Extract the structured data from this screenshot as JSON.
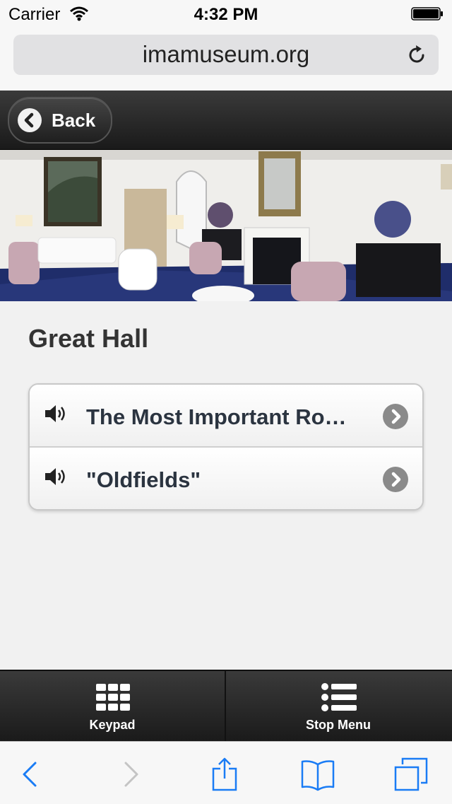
{
  "status_bar": {
    "carrier": "Carrier",
    "time": "4:32 PM",
    "wifi_icon": "wifi-icon",
    "battery_icon": "battery-icon"
  },
  "browser": {
    "url": "imamuseum.org",
    "reload_icon": "reload-icon"
  },
  "header": {
    "back_label": "Back",
    "back_icon": "chevron-left-icon"
  },
  "hero": {
    "icon": "room-photo"
  },
  "page": {
    "title": "Great Hall",
    "stops": [
      {
        "label": "The Most Important Ro…",
        "icon": "speaker-icon",
        "action_icon": "chevron-right-icon"
      },
      {
        "label": "\"Oldfields\"",
        "icon": "speaker-icon",
        "action_icon": "chevron-right-icon"
      }
    ]
  },
  "toolbar": {
    "keypad_label": "Keypad",
    "keypad_icon": "keypad-grid-icon",
    "stop_menu_label": "Stop Menu",
    "stop_menu_icon": "list-icon"
  },
  "safari_bar": {
    "icons": [
      "back-icon",
      "forward-icon",
      "share-icon",
      "bookmarks-icon",
      "tabs-icon"
    ]
  },
  "colors": {
    "accent_blue": "#1a7cf5",
    "header_dark": "#1a1a1a",
    "title_text": "#333333",
    "stop_text": "#2b3440"
  }
}
